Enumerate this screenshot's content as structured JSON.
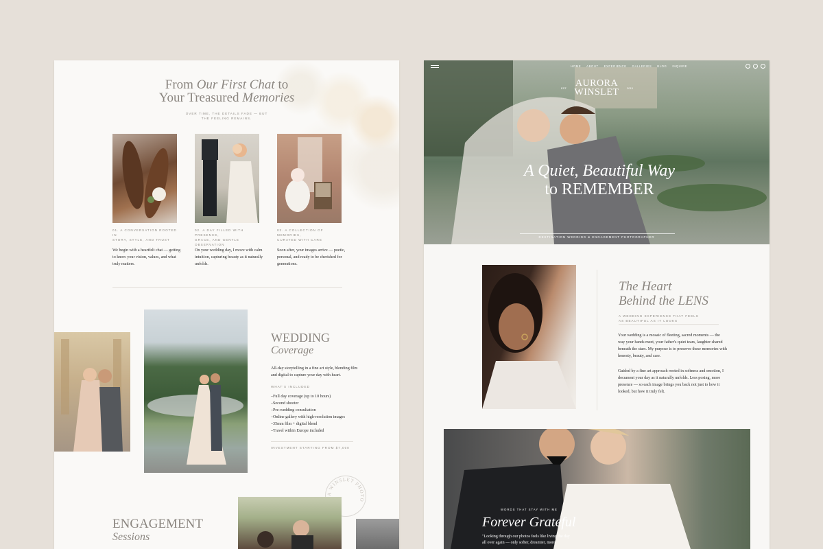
{
  "left_page": {
    "hero": {
      "line1_plain": "From ",
      "line1_italic": "Our First Chat",
      "line1_end": " to",
      "line2_plain": "Your Treasured ",
      "line2_italic": "Memories",
      "subtitle_line1": "OVER TIME, THE DETAILS FADE — BUT",
      "subtitle_line2": "THE FEELING REMAINS."
    },
    "steps": [
      {
        "caption_line1": "01. A CONVERSATION ROOTED IN",
        "caption_line2": "STORY, STYLE, AND TRUST",
        "text": "We begin with a heartfelt chat — getting to know your vision, values, and what truly matters."
      },
      {
        "caption_line1": "02. A DAY FILLED WITH PRESENCE,",
        "caption_line2": "GRACE, AND GENTLE OBSERVATION",
        "text": "On your wedding day, I move with calm intuition, capturing beauty as it naturally unfolds."
      },
      {
        "caption_line1": "03. A COLLECTION OF MEMORIES,",
        "caption_line2": "CURATED WITH CARE",
        "text": "Soon after, your images arrive — poetic, personal, and ready to be cherished for generations."
      }
    ],
    "wedding": {
      "title": "WEDDING",
      "subtitle": "Coverage",
      "description": "All-day storytelling in a fine art style, blending film and digital to capture your day with heart.",
      "included_label": "WHAT'S INCLUDED",
      "included": [
        "–Full day coverage (up to 10 hours)",
        "–Second shooter",
        "–Pre-wedding consultation",
        "–Online gallery with high-resolution images",
        "–35mm film + digital blend",
        "–Travel within Europe included"
      ],
      "investment": "INVESTMENT STARTING FROM $7,000"
    },
    "engagement": {
      "title": "ENGAGEMENT",
      "subtitle": "Sessions"
    },
    "stamp_text": "A WINSLET PHOTO"
  },
  "right_page": {
    "nav": [
      "HOME",
      "ABOUT",
      "EXPERIENCE",
      "GALLERIES",
      "BLOG",
      "INQUIRE"
    ],
    "logo": {
      "line1": "AURORA",
      "line2": "WINSLET",
      "est": "EST.",
      "year": "2013"
    },
    "hero": {
      "line1_italic": "A Quiet, Beautiful Way",
      "line2_plain": "to REMEMBER",
      "caption": "DESTINATION WEDDING & ENGAGEMENT PHOTOGRAPHER"
    },
    "about": {
      "title_line1": "The Heart",
      "title_line2": "Behind the LENS",
      "subtitle_line1": "A WEDDING EXPERIENCE THAT FEELS",
      "subtitle_line2": "AS BEAUTIFUL AS IT LOOKS",
      "paragraph1": "Your wedding is a mosaic of fleeting, sacred moments — the way your hands meet, your father's quiet tears, laughter shared beneath the stars. My purpose is to preserve these memories with honesty, beauty, and care.",
      "paragraph2": "Guided by a fine art approach rooted in softness and emotion, I document your day as it naturally unfolds. Less posing, more presence — so each image brings you back not just to how it looked, but how it truly felt."
    },
    "testimonials": {
      "label": "WORDS THAT STAY WITH ME",
      "title": "Forever Grateful",
      "quote": "\"Looking through our photos feels like living the day all over again — only softer, dreamier, more"
    }
  },
  "colors": {
    "background": "#e6e0d9",
    "page": "#faf9f7",
    "heading_gray": "#8b8680",
    "body_text": "#2e2e2e",
    "caption_gray": "#8e8a84"
  }
}
